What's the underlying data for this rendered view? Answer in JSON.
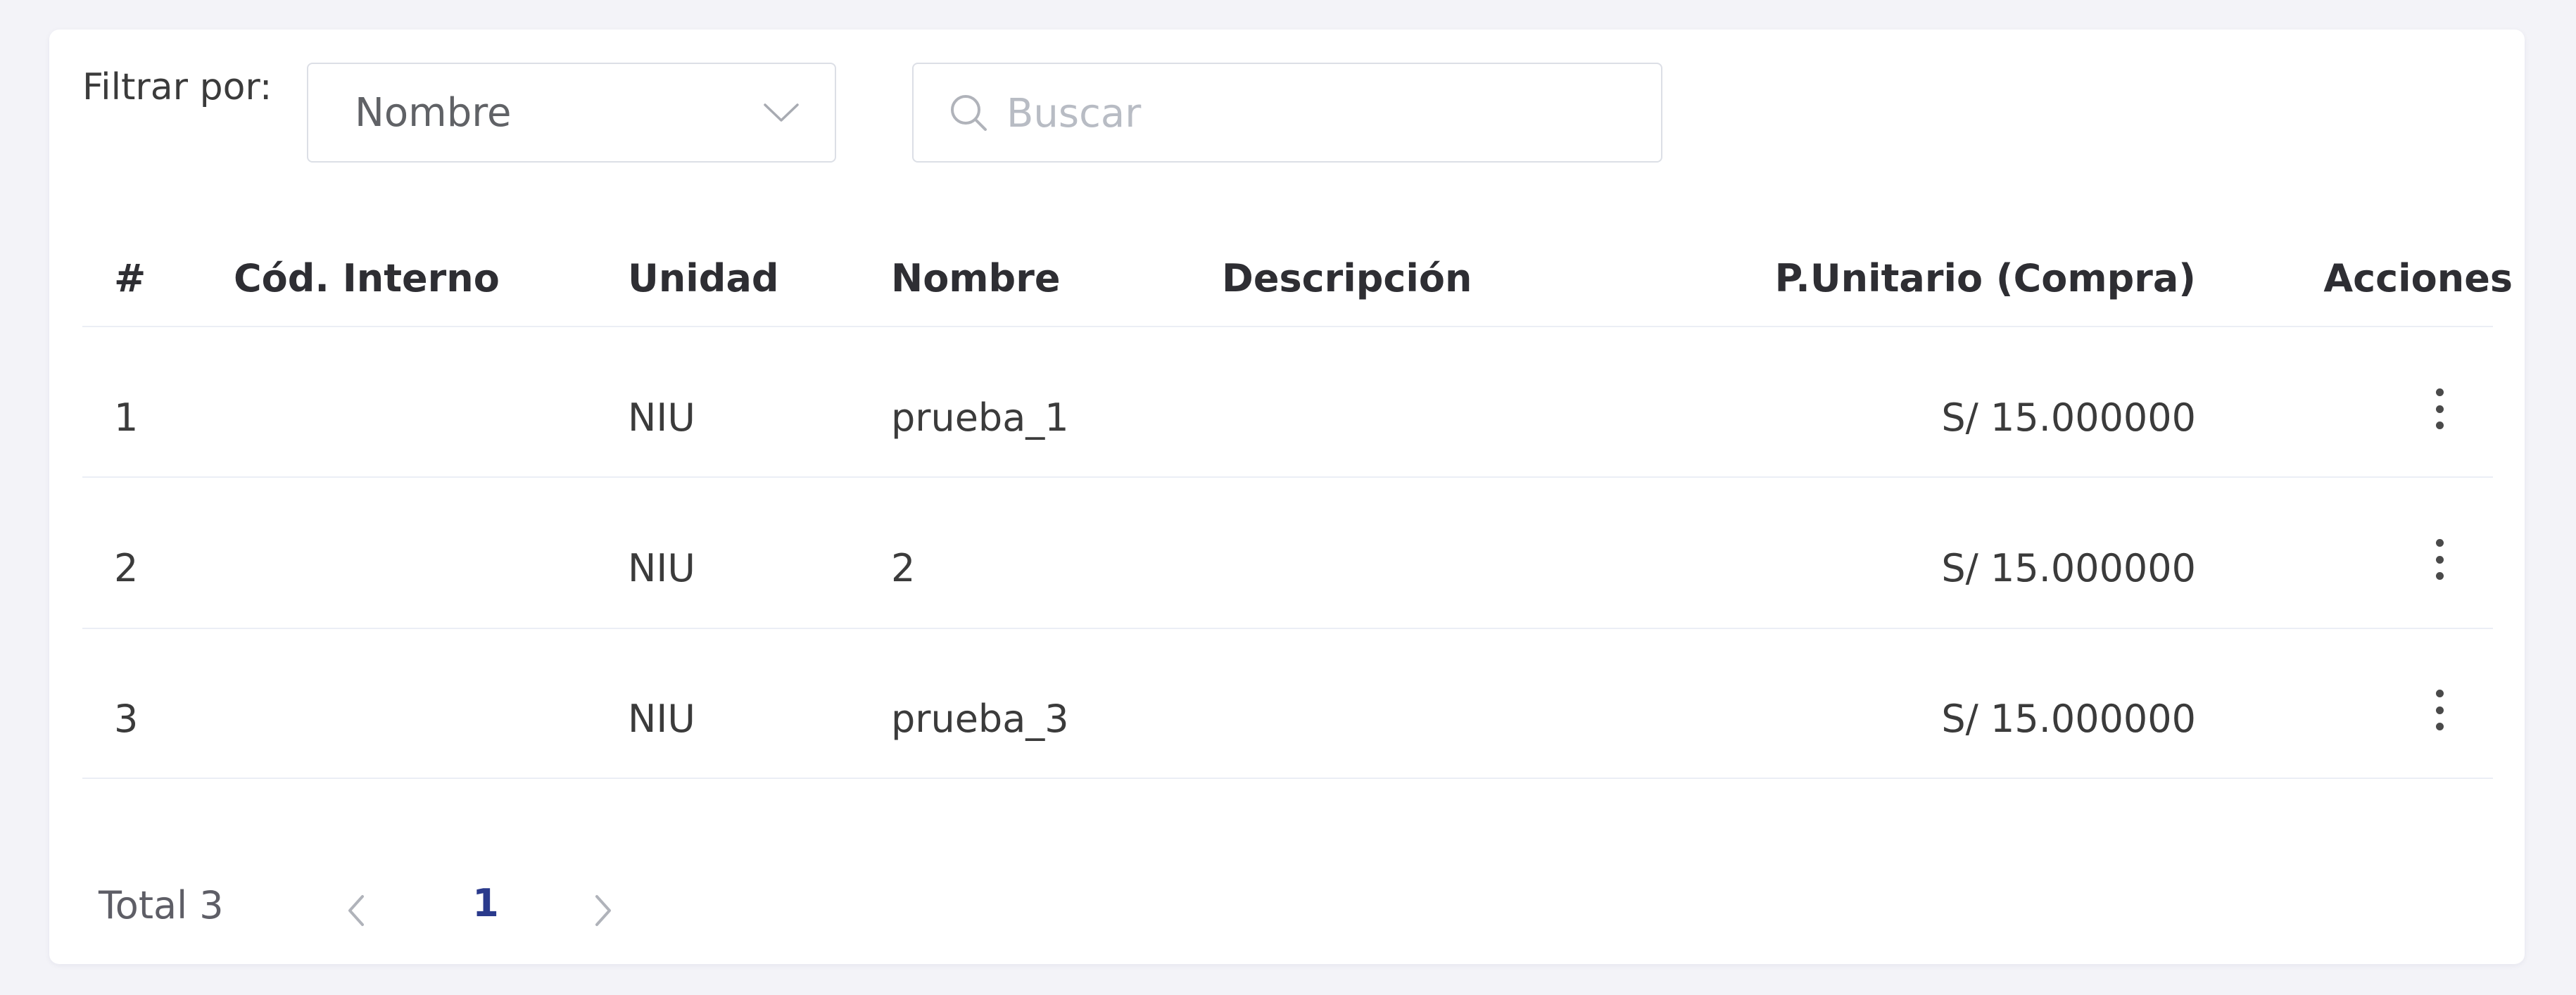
{
  "filter": {
    "label": "Filtrar por:",
    "selected": "Nombre",
    "chevron_icon": "chevron-down-icon"
  },
  "search": {
    "placeholder": "Buscar",
    "value": "",
    "icon": "search-icon"
  },
  "table": {
    "headers": [
      "#",
      "Cód. Interno",
      "Unidad",
      "Nombre",
      "Descripción",
      "P.Unitario (Compra)",
      "Acciones"
    ],
    "rows": [
      {
        "index": "1",
        "codigo": "",
        "unidad": "NIU",
        "nombre": "prueba_1",
        "descripcion": "",
        "precio": "S/ 15.000000"
      },
      {
        "index": "2",
        "codigo": "",
        "unidad": "NIU",
        "nombre": "2",
        "descripcion": "",
        "precio": "S/ 15.000000"
      },
      {
        "index": "3",
        "codigo": "",
        "unidad": "NIU",
        "nombre": "prueba_3",
        "descripcion": "",
        "precio": "S/ 15.000000"
      }
    ],
    "row_action_icon": "more-vertical-icon"
  },
  "pagination": {
    "total": "Total 3",
    "current_page": "1"
  },
  "colors": {
    "background": "#f3f3f8",
    "card": "#ffffff",
    "border": "#dcdfe6",
    "divider": "#ebeef5",
    "header_text": "#2e2e33",
    "body_text": "#3b3b3b",
    "active_page": "#2a3a8c",
    "placeholder": "#b8bcc4"
  }
}
